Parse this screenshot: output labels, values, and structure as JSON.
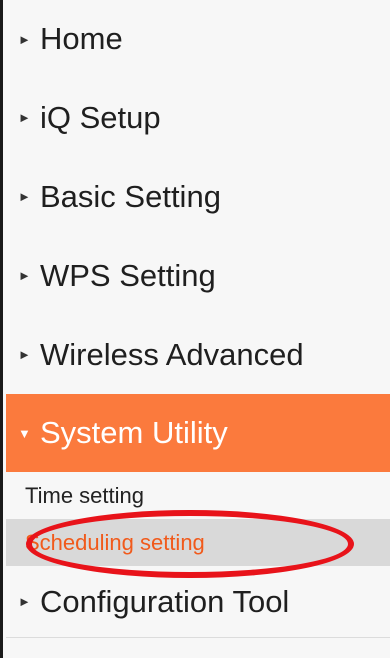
{
  "menu": {
    "items": [
      {
        "label": "Home",
        "arrow": "►"
      },
      {
        "label": "iQ Setup",
        "arrow": "►"
      },
      {
        "label": "Basic Setting",
        "arrow": "►"
      },
      {
        "label": "WPS Setting",
        "arrow": "►"
      },
      {
        "label": "Wireless Advanced",
        "arrow": "►"
      },
      {
        "label": "System Utility",
        "arrow": "▼"
      },
      {
        "label": "Configuration Tool",
        "arrow": "►"
      }
    ],
    "subitems": [
      {
        "label": "Time setting"
      },
      {
        "label": "Scheduling setting"
      }
    ]
  },
  "colors": {
    "active_bg": "#fb7a3d",
    "selected_text": "#f15a1b",
    "highlight_ring": "#e8131a"
  }
}
